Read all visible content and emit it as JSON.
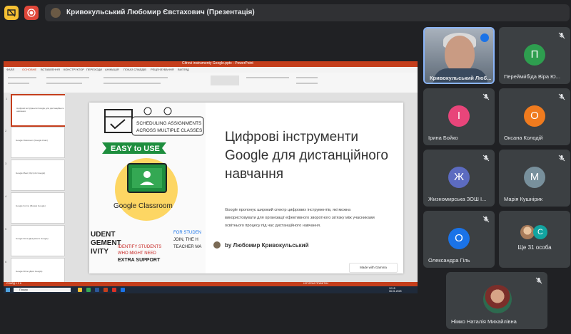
{
  "header": {
    "presenter_label": "Кривокульський Любомир Євстахович (Презентація)"
  },
  "powerpoint": {
    "window_title": "Cifrovi instrumenty Google.pptx - PowerPoint",
    "tabs": [
      "ФАЙЛ",
      "ОСНОВНЕ",
      "ВСТАВЛЕННЯ",
      "КОНСТРУКТОР",
      "ПЕРЕХОДИ",
      "АНІМАЦІЯ",
      "ПОКАЗ СЛАЙДІВ",
      "РЕЦЕНЗУВАННЯ",
      "ВИГЛЯД"
    ],
    "slide_thumbnails": [
      {
        "number": "1",
        "title": "Цифрові інструменти Google для дистанційного навчання"
      },
      {
        "number": "2",
        "title": "Google Classroom (Google Клас)"
      },
      {
        "number": "3",
        "title": "Google Meet (Зустрічі Google)"
      },
      {
        "number": "4",
        "title": "Google Forms (Форми Google)"
      },
      {
        "number": "5",
        "title": "Google Docs (Документи Google)"
      },
      {
        "number": "6",
        "title": "Google Drive (Диск Google)"
      }
    ],
    "slide": {
      "title": "Цифрові інструменти Google для дистанційного навчання",
      "body": "Google пропонує широкий спектр цифрових інструментів, які можна використовувати для організації ефективного зворотного зв'язку між учасниками освітнього процесу під час дистанційного навчання.",
      "author": "by Любомир Кривокульський",
      "badge": "Made with Gamma",
      "illustration_texts": [
        "SCHEDULING ASSIGNMENTS ACROSS MULTIPLE CLASSES",
        "EASY to USE",
        "Google Classroom",
        "IDENTIFY STUDENTS WHO MIGHT NEED EXTRA SUPPORT"
      ]
    },
    "status_left": "СЛАЙД 1 З 6",
    "status_right": "НОТАТКИ  ПРИМІТКИ"
  },
  "taskbar": {
    "search_placeholder": "Пошук",
    "time": "12:15",
    "date": "06.01.2025"
  },
  "participants": [
    {
      "name": "Кривокульський Люб...",
      "initial": "",
      "color": "",
      "speaking": true
    },
    {
      "name": "Перейми́біда Віра Ю...",
      "initial": "П",
      "color": "#2e9e4f"
    },
    {
      "name": "Ірина Бойко",
      "initial": "І",
      "color": "#e8457a"
    },
    {
      "name": "Оксана Колодій",
      "initial": "О",
      "color": "#f07b1e"
    },
    {
      "name": "Жизномирська ЗОШ І...",
      "initial": "Ж",
      "color": "#5c6bc0"
    },
    {
      "name": "Марія Кушнірик",
      "initial": "М",
      "color": "#78909c"
    },
    {
      "name": "Олександра Гіль",
      "initial": "О",
      "color": "#1a73e8"
    },
    {
      "name": "Німко Наталія Михайлівна",
      "initial": "",
      "color": ""
    }
  ],
  "others": {
    "label": "Ще 31 особа",
    "stack_initial": "С"
  }
}
